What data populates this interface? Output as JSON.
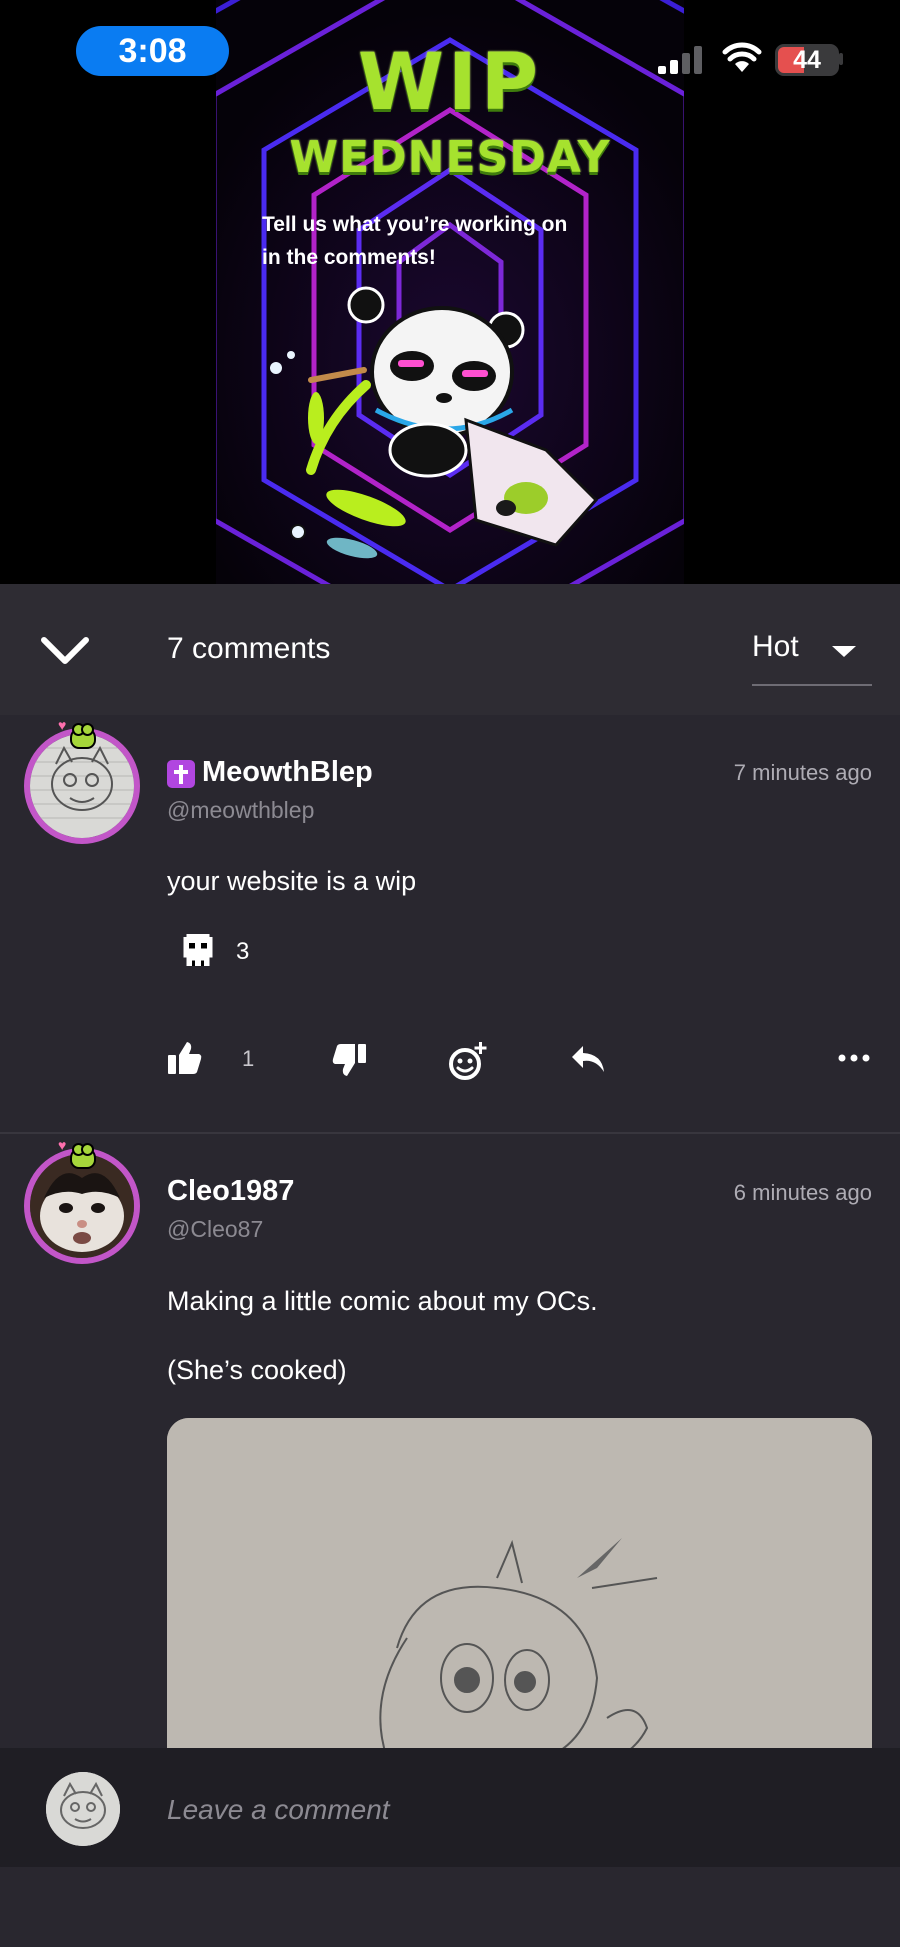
{
  "status_bar": {
    "time": "3:08",
    "battery": "44",
    "battery_level": 0.44,
    "signal_bars": 2
  },
  "post_media": {
    "title_line1": "WIP",
    "title_line2": "WEDNESDAY",
    "subtitle_line1": "Tell us what you’re working on",
    "subtitle_line2": "in the comments!"
  },
  "comments_header": {
    "count_label": "7 comments",
    "sort_label": "Hot"
  },
  "comments": [
    {
      "username": "MeowthBlep",
      "handle": "@meowthblep",
      "timestamp": "7 minutes ago",
      "badge_icon": "cross-badge-icon",
      "body": [
        "your website is a wip"
      ],
      "reactions": [
        {
          "icon": "skull-icon",
          "count": "3"
        }
      ],
      "likes": "1"
    },
    {
      "username": "Cleo1987",
      "handle": "@Cleo87",
      "timestamp": "6 minutes ago",
      "body": [
        "Making a little comic about my OCs.",
        "(She’s cooked)"
      ]
    }
  ],
  "composer": {
    "placeholder": "Leave a comment"
  },
  "colors": {
    "background": "#29272f",
    "header_bar": "#2e2c33",
    "avatar_ring": "#c256c8",
    "badge": "#b146e0",
    "time_pill": "#0a7cf2",
    "poster_green": "#a6e22e"
  }
}
